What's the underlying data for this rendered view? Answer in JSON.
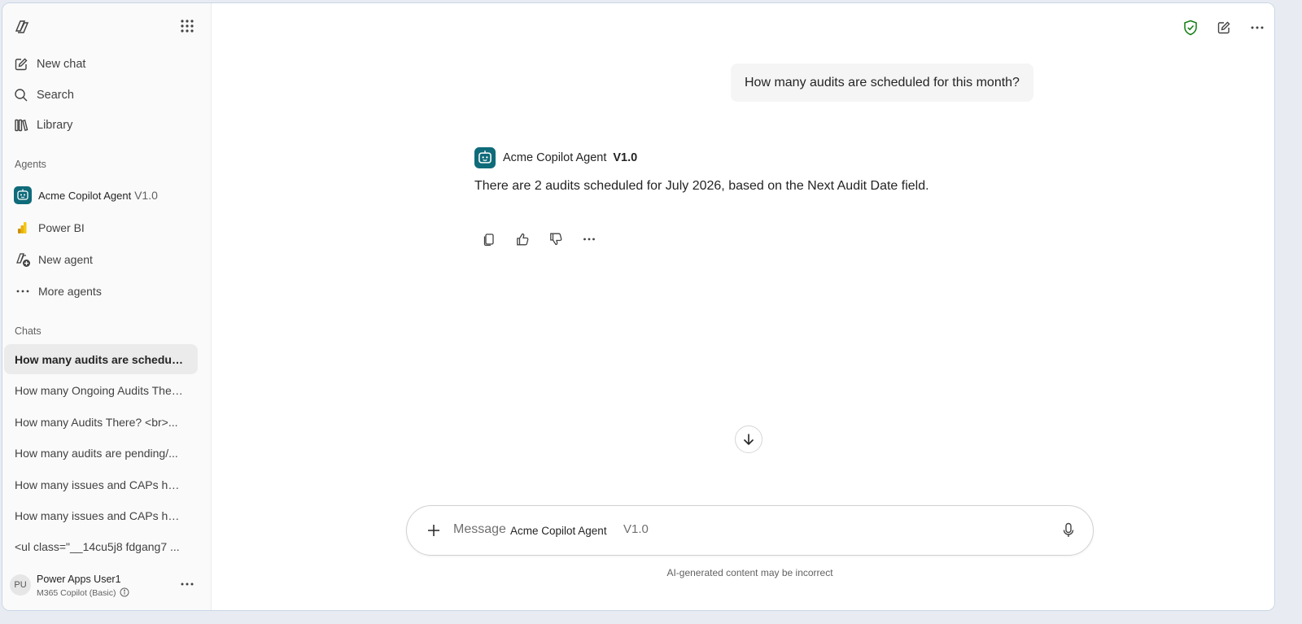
{
  "sidebar": {
    "nav": [
      {
        "label": "New chat",
        "icon": "compose-icon"
      },
      {
        "label": "Search",
        "icon": "search-icon"
      },
      {
        "label": "Library",
        "icon": "library-icon"
      }
    ],
    "agents_heading": "Agents",
    "agents": [
      {
        "label": "Acme Copilot Agent",
        "version": "V1.0",
        "icon": "bot-avatar-icon"
      },
      {
        "label": "Power BI",
        "icon": "powerbi-icon"
      },
      {
        "label": "New agent",
        "icon": "new-agent-icon"
      },
      {
        "label": "More agents",
        "icon": "more-horizontal-icon"
      }
    ],
    "chats_heading": "Chats",
    "chats": [
      "How many audits are scheduled for this month?",
      "How many Ongoing Audits There?",
      "How many Audits There? <br>...",
      "How many audits are pending/...",
      "How many issues and CAPs have...",
      "How many issues and CAPs have...",
      "<ul class=\"__14cu5j8 fdgang7 ..."
    ],
    "user": {
      "initials": "PU",
      "name": "Power Apps User1",
      "plan": "M365 Copilot (Basic)"
    }
  },
  "conversation": {
    "user_message": "How many audits are scheduled for this month?",
    "agent_name": "Acme Copilot Agent",
    "agent_version": "V1.0",
    "agent_answer": "There are 2 audits scheduled for July 2026, based on the Next Audit Date field."
  },
  "composer": {
    "placeholder": "Message",
    "agent_name": "Acme Copilot Agent",
    "agent_version": "V1.0",
    "disclaimer": "AI-generated content may be incorrect"
  },
  "colors": {
    "shield_green": "#107c10",
    "bot_teal": "#0f6b7a",
    "powerbi_yellow": "#f2c811",
    "active_chat_bg": "#ebebeb"
  }
}
